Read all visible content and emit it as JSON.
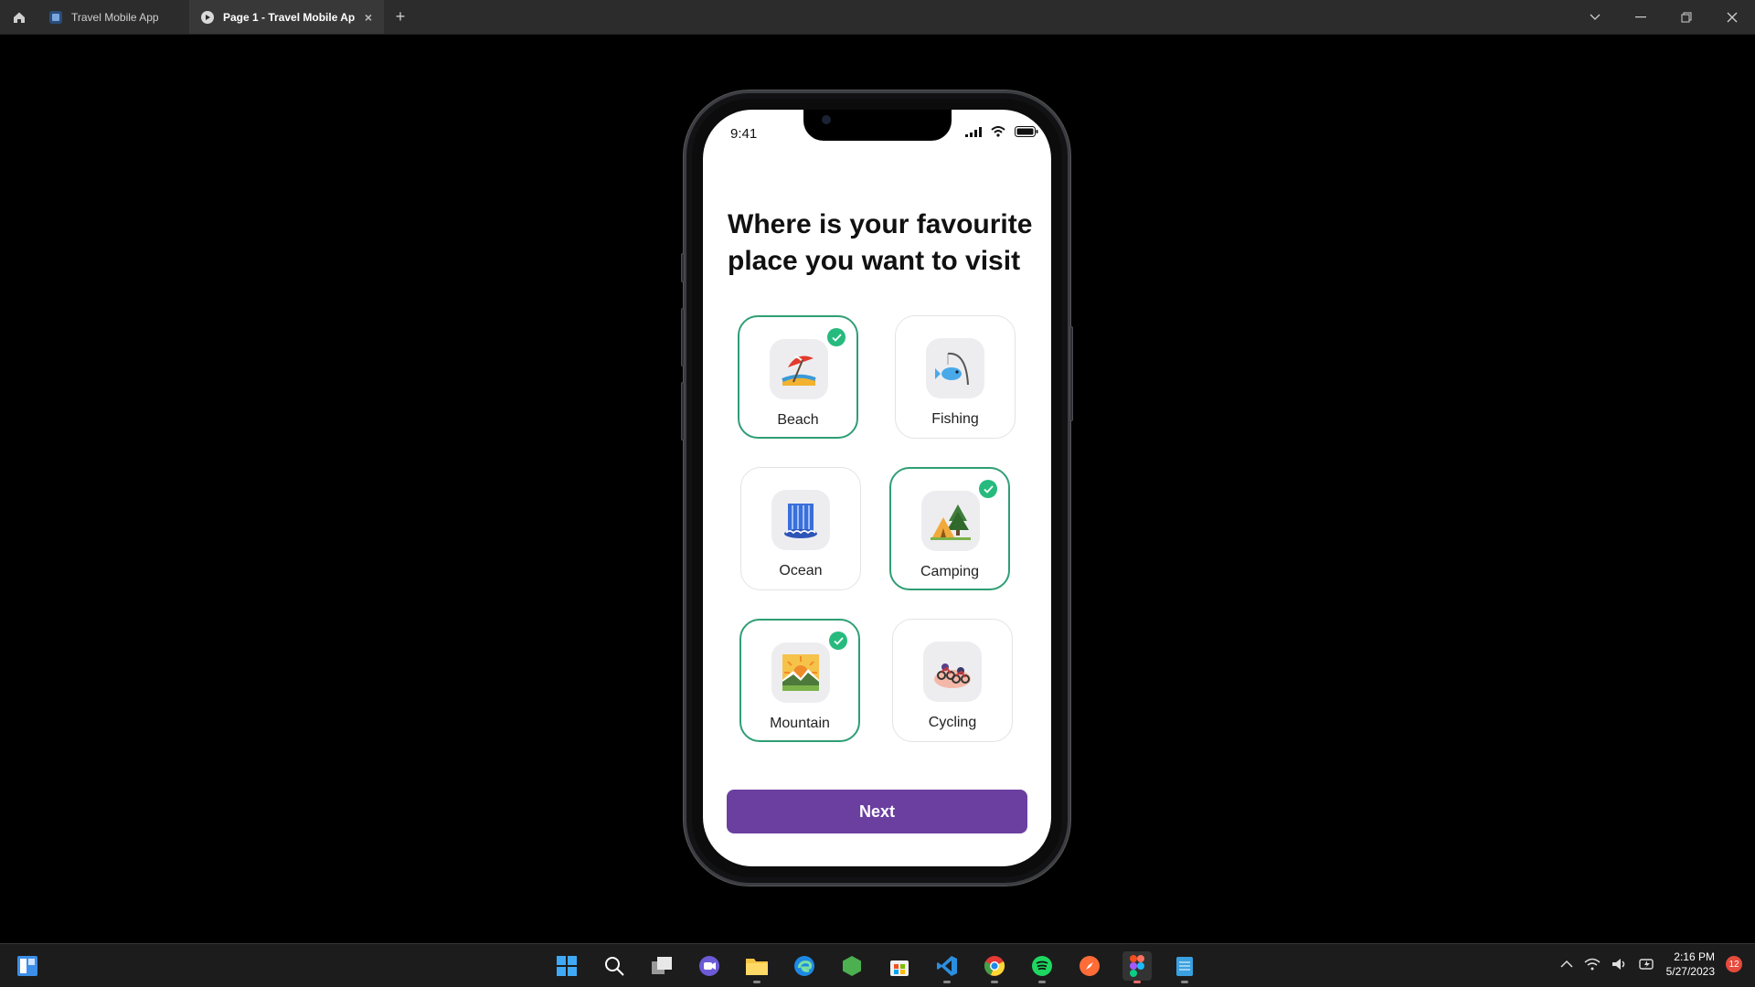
{
  "browser": {
    "tabs": [
      {
        "label": "Travel Mobile App"
      },
      {
        "label": "Page 1 - Travel Mobile App"
      }
    ],
    "add_tab": "+",
    "close": "×"
  },
  "status_bar": {
    "time": "9:41"
  },
  "screen": {
    "heading": "Where is your favourite place you want to visit",
    "options": [
      {
        "label": "Beach",
        "selected": true,
        "icon": "beach-umbrella-icon"
      },
      {
        "label": "Fishing",
        "selected": false,
        "icon": "fishing-pole-icon"
      },
      {
        "label": "Ocean",
        "selected": false,
        "icon": "waterfall-icon"
      },
      {
        "label": "Camping",
        "selected": true,
        "icon": "camping-icon"
      },
      {
        "label": "Mountain",
        "selected": true,
        "icon": "sunrise-mountain-icon"
      },
      {
        "label": "Cycling",
        "selected": false,
        "icon": "cyclists-icon"
      }
    ],
    "next_label": "Next"
  },
  "colors": {
    "accent": "#6b3fa0",
    "selected_border": "#2f9e74",
    "check": "#27ba7e"
  },
  "taskbar": {
    "clock_time": "2:16 PM",
    "clock_date": "5/27/2023",
    "notification_count": "12"
  }
}
